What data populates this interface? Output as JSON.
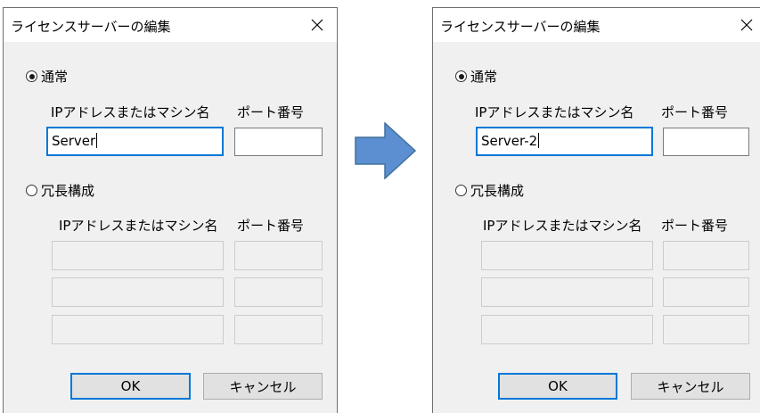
{
  "dialogs": [
    {
      "title": "ライセンスサーバーの編集",
      "close_glyph": "✕",
      "normal": {
        "label": "通常",
        "selected": true,
        "address_header": "IPアドレスまたはマシン名",
        "port_header": "ポート番号",
        "address_value": "Server",
        "port_value": ""
      },
      "redundant": {
        "label": "冗長構成",
        "selected": false,
        "address_header": "IPアドレスまたはマシン名",
        "port_header": "ポート番号",
        "rows": 3
      },
      "ok_label": "OK",
      "cancel_label": "キャンセル"
    },
    {
      "title": "ライセンスサーバーの編集",
      "close_glyph": "✕",
      "normal": {
        "label": "通常",
        "selected": true,
        "address_header": "IPアドレスまたはマシン名",
        "port_header": "ポート番号",
        "address_value": "Server-2",
        "port_value": ""
      },
      "redundant": {
        "label": "冗長構成",
        "selected": false,
        "address_header": "IPアドレスまたはマシン名",
        "port_header": "ポート番号",
        "rows": 3
      },
      "ok_label": "OK",
      "cancel_label": "キャンセル"
    }
  ],
  "arrow": {
    "icon": "right-arrow-icon",
    "color": "#5b8fd1"
  }
}
